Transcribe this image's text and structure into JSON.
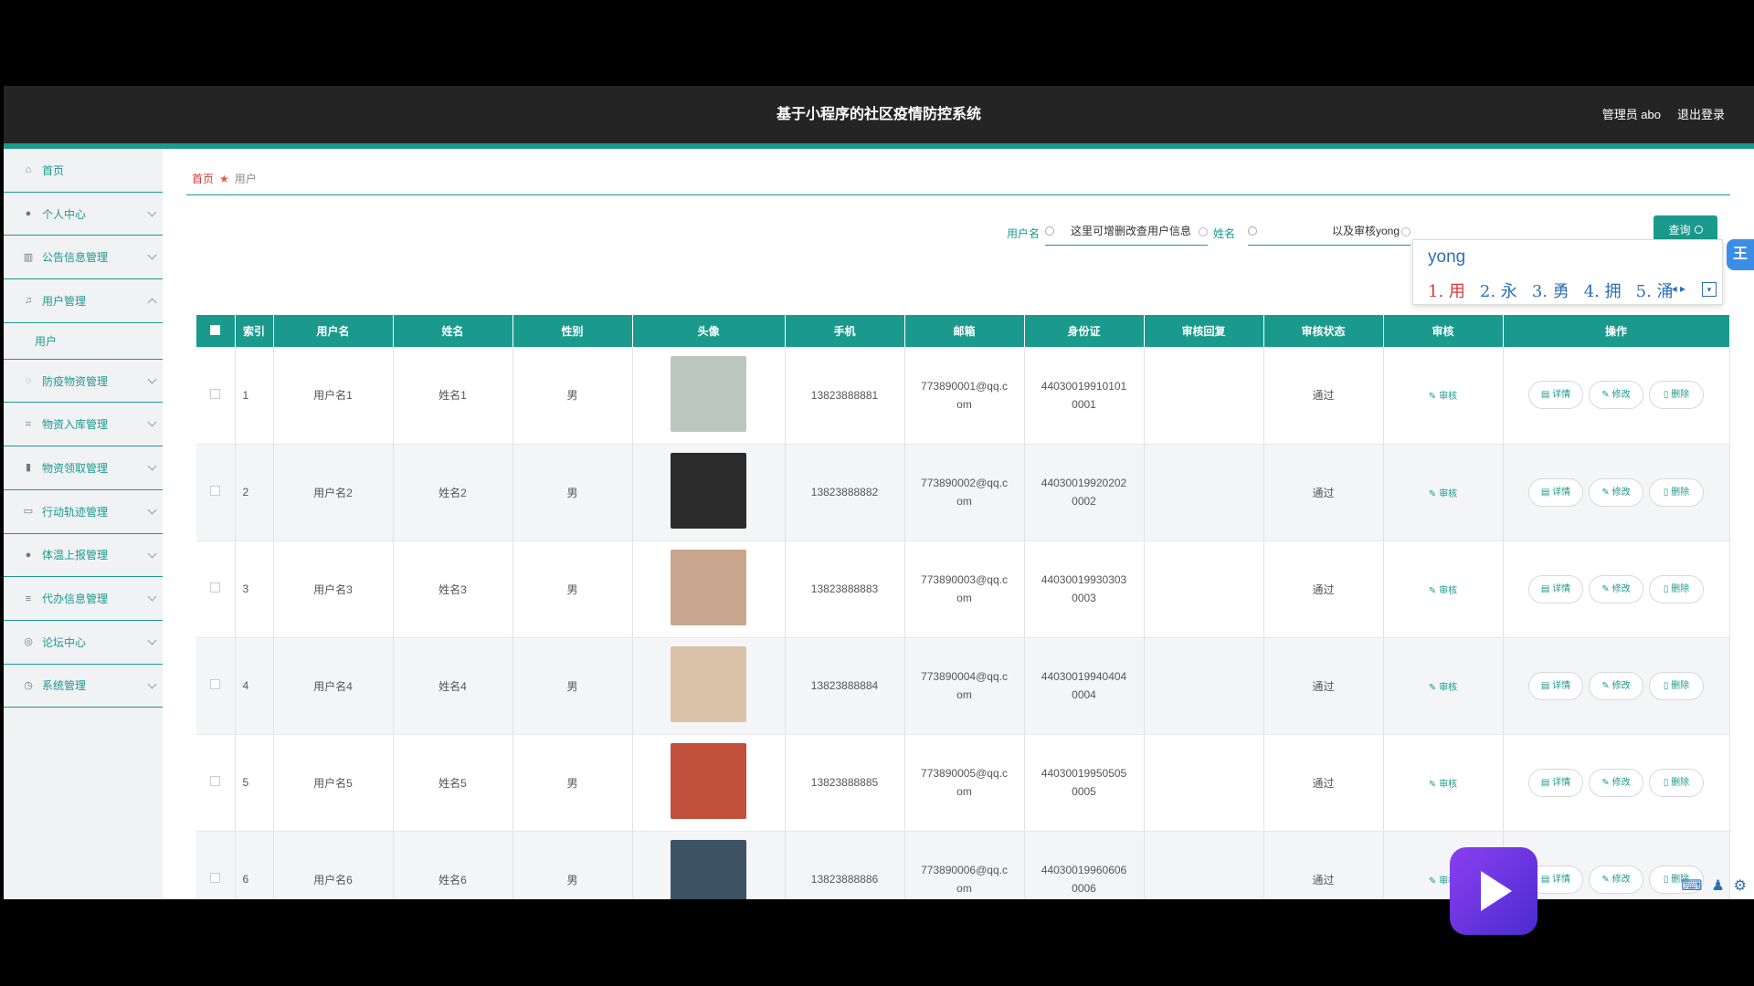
{
  "header": {
    "title": "基于小程序的社区疫情防控系统",
    "user": "管理员 abo",
    "logout": "退出登录"
  },
  "sidebar": {
    "items": [
      {
        "label": "首页",
        "icon": "home-icon",
        "glyph": "⌂",
        "chevron": ""
      },
      {
        "label": "个人中心",
        "icon": "person-icon",
        "glyph": "●",
        "chevron": "down"
      },
      {
        "label": "公告信息管理",
        "icon": "chart-icon",
        "glyph": "▥",
        "chevron": "down"
      },
      {
        "label": "用户管理",
        "icon": "mic-icon",
        "glyph": "♫",
        "chevron": "up"
      },
      {
        "label": "防疫物资管理",
        "icon": "power-icon",
        "glyph": "◌",
        "chevron": "down"
      },
      {
        "label": "物资入库管理",
        "icon": "crop-icon",
        "glyph": "⌗",
        "chevron": "down"
      },
      {
        "label": "物资领取管理",
        "icon": "bar-icon",
        "glyph": "▮",
        "chevron": "down"
      },
      {
        "label": "行动轨迹管理",
        "icon": "card-icon",
        "glyph": "▭",
        "chevron": "down"
      },
      {
        "label": "体温上报管理",
        "icon": "person-icon",
        "glyph": "●",
        "chevron": "down"
      },
      {
        "label": "代办信息管理",
        "icon": "list-icon",
        "glyph": "≡",
        "chevron": "down"
      },
      {
        "label": "论坛中心",
        "icon": "compass-icon",
        "glyph": "◎",
        "chevron": "down"
      },
      {
        "label": "系统管理",
        "icon": "clock-icon",
        "glyph": "◷",
        "chevron": "down"
      }
    ],
    "sub_item": "用户"
  },
  "breadcrumb": {
    "home": "首页",
    "current": "用户"
  },
  "search": {
    "username_label": "用户名",
    "username_value": "这里可增删改查用户信息",
    "name_label": "姓名",
    "name_value": "以及审核yong",
    "query_label": "查询"
  },
  "table": {
    "headers": [
      "",
      "索引",
      "用户名",
      "姓名",
      "性别",
      "头像",
      "手机",
      "邮箱",
      "身份证",
      "审核回复",
      "审核状态",
      "审核",
      "操作"
    ],
    "rows": [
      {
        "index": "1",
        "username": "用户名1",
        "name": "姓名1",
        "gender": "男",
        "phone": "13823888881",
        "email": "773890001@qq.com",
        "id": "440300199101010001",
        "reply": "",
        "status": "通过",
        "avatar_color": "#b9c7c0"
      },
      {
        "index": "2",
        "username": "用户名2",
        "name": "姓名2",
        "gender": "男",
        "phone": "13823888882",
        "email": "773890002@qq.com",
        "id": "440300199202020002",
        "reply": "",
        "status": "通过",
        "avatar_color": "#2b2b2b"
      },
      {
        "index": "3",
        "username": "用户名3",
        "name": "姓名3",
        "gender": "男",
        "phone": "13823888883",
        "email": "773890003@qq.com",
        "id": "440300199303030003",
        "reply": "",
        "status": "通过",
        "avatar_color": "#c8a58c"
      },
      {
        "index": "4",
        "username": "用户名4",
        "name": "姓名4",
        "gender": "男",
        "phone": "13823888884",
        "email": "773890004@qq.com",
        "id": "440300199404040004",
        "reply": "",
        "status": "通过",
        "avatar_color": "#d9c2a8"
      },
      {
        "index": "5",
        "username": "用户名5",
        "name": "姓名5",
        "gender": "男",
        "phone": "13823888885",
        "email": "773890005@qq.com",
        "id": "440300199505050005",
        "reply": "",
        "status": "通过",
        "avatar_color": "#c0503c"
      },
      {
        "index": "6",
        "username": "用户名6",
        "name": "姓名6",
        "gender": "男",
        "phone": "13823888886",
        "email": "773890006@qq.com",
        "id": "440300199606060006",
        "reply": "",
        "status": "通过",
        "avatar_color": "#3d5363"
      }
    ],
    "audit_label": "审核",
    "ops": {
      "detail": "详情",
      "edit": "修改",
      "delete": "删除"
    }
  },
  "ime": {
    "code": "yong",
    "candidates": [
      "1. 用",
      "2. 永",
      "3. 勇",
      "4. 拥",
      "5. 涌"
    ],
    "tab": "王"
  }
}
